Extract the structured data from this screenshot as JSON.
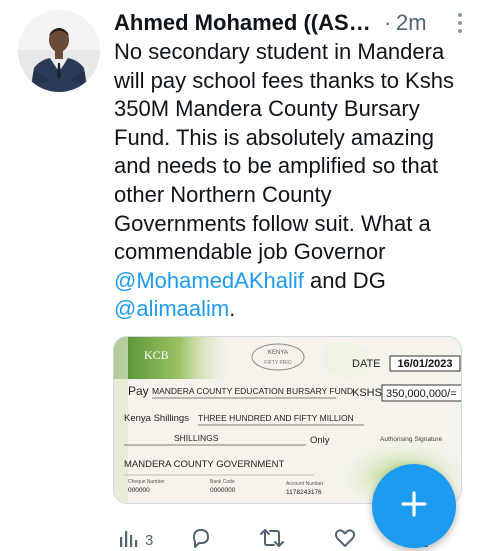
{
  "tweet": {
    "author_name": "Ahmed Mohamed ((ASM...",
    "separator": "·",
    "time_ago": "2m",
    "text_before_mention_1": "No secondary student in Mandera will pay school fees thanks to Kshs 350M Mandera County Bursary Fund. This is absolutely amazing and needs to be amplified so that other Northern County Governments follow suit. What a commendable job Governor ",
    "mention_1": "@MohamedAKhalif",
    "text_between_mentions": " and DG ",
    "mention_2": "@alimaalim",
    "text_after_mention_2": ".",
    "more_icon": "more-vertical-icon"
  },
  "cheque": {
    "bank": "KCB",
    "stamp": "KENYA",
    "stamp_sub": "FIFTY PRIO",
    "date_label": "DATE",
    "date_value": "16/01/2023",
    "pay_label": "Pay",
    "payee": "MANDERA COUNTY EDUCATION BURSARY FUND",
    "amount_label": "KSHS",
    "amount_value": "350,000,000/=",
    "words_label": "Kenya Shillings",
    "amount_words": "THREE HUNDRED AND FIFTY MILLION",
    "words_line2": "SHILLINGS",
    "only_label": "Only",
    "signature_label": "Authorising Signature",
    "issuer": "MANDERA COUNTY GOVERNMENT",
    "cheque_no_label": "Cheque Number",
    "cheque_no": "000000",
    "bank_code_label": "Bank Code",
    "bank_code": "0000000",
    "account_no_label": "Account Number",
    "account_no": "1178243176"
  },
  "actions": {
    "views_icon": "analytics-icon",
    "views_count": "3",
    "reply_icon": "reply-icon",
    "retweet_icon": "retweet-icon",
    "like_icon": "heart-icon"
  },
  "compose": {
    "icon": "plus-icon",
    "color": "#1d9bf0"
  },
  "colors": {
    "text": "#0f1419",
    "secondary": "#536471",
    "link": "#1d9bf0"
  }
}
